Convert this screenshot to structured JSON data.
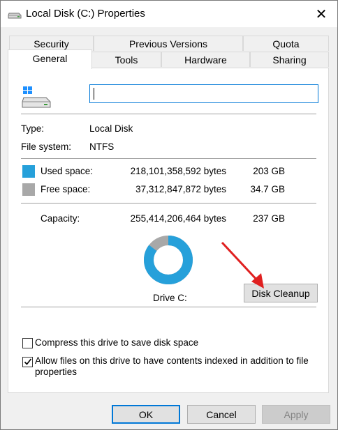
{
  "window": {
    "title": "Local Disk (C:) Properties",
    "close_glyph": "✕",
    "icon": "drive-icon"
  },
  "tabs": {
    "row1": [
      "Security",
      "Previous Versions",
      "Quota"
    ],
    "row2": [
      "General",
      "Tools",
      "Hardware",
      "Sharing"
    ],
    "active": "General"
  },
  "general": {
    "drive_name_value": "",
    "type_label": "Type:",
    "type_value": "Local Disk",
    "fs_label": "File system:",
    "fs_value": "NTFS",
    "used": {
      "label": "Used space:",
      "bytes": "218,101,358,592 bytes",
      "size": "203 GB",
      "color": "#26a0da"
    },
    "free": {
      "label": "Free space:",
      "bytes": "37,312,847,872 bytes",
      "size": "34.7 GB",
      "color": "#a8a8a8"
    },
    "capacity": {
      "label": "Capacity:",
      "bytes": "255,414,206,464 bytes",
      "size": "237 GB"
    },
    "used_fraction": 0.854,
    "drive_label": "Drive C:",
    "disk_cleanup_label": "Disk Cleanup",
    "compress_label": "Compress this drive to save disk space",
    "compress_checked": false,
    "index_label_line1": "Allow files on this drive to have contents indexed in addition to file",
    "index_label_line2": "properties",
    "index_checked": true
  },
  "buttons": {
    "ok": "OK",
    "cancel": "Cancel",
    "apply": "Apply"
  },
  "annotation": {
    "arrow_color": "#e02020",
    "icon": "red-arrow-icon"
  }
}
